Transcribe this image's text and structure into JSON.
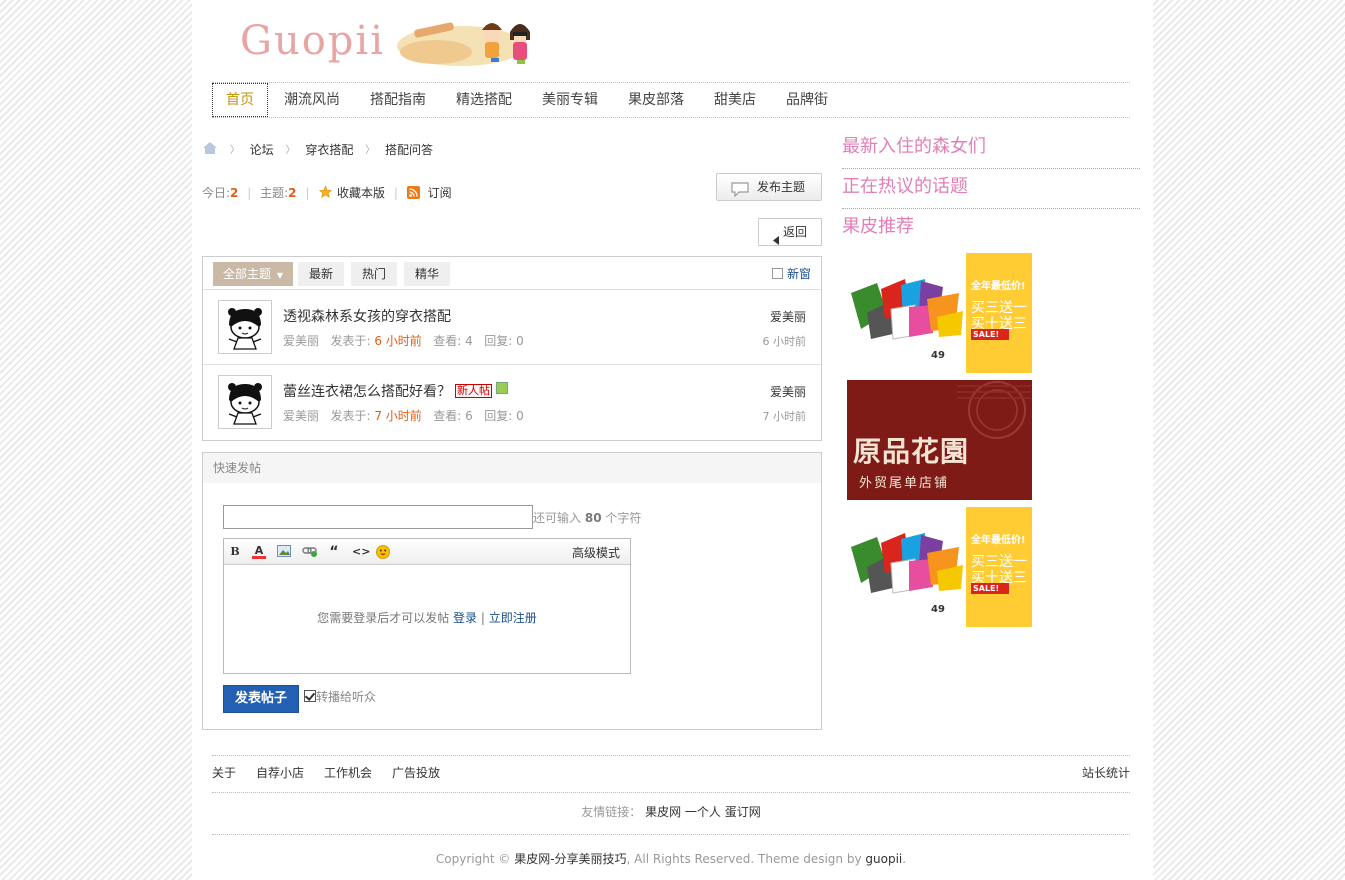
{
  "logo": {
    "text": "Guopii"
  },
  "nav": [
    {
      "label": "首页",
      "active": true
    },
    {
      "label": "潮流风尚"
    },
    {
      "label": "搭配指南"
    },
    {
      "label": "精选搭配"
    },
    {
      "label": "美丽专辑"
    },
    {
      "label": "果皮部落"
    },
    {
      "label": "甜美店"
    },
    {
      "label": "品牌街"
    }
  ],
  "breadcrumb": [
    "论坛",
    "穿衣搭配",
    "搭配问答"
  ],
  "stats": {
    "today_label": "今日:",
    "today_value": "2",
    "topics_label": "主题:",
    "topics_value": "2",
    "favorite_label": "收藏本版",
    "subscribe_label": "订阅"
  },
  "buttons": {
    "post": "发布主题",
    "back": "返回"
  },
  "tabs": [
    {
      "label": "全部主题",
      "active": true
    },
    {
      "label": "最新"
    },
    {
      "label": "热门"
    },
    {
      "label": "精华"
    }
  ],
  "new_window_label": "新窗",
  "threads": [
    {
      "title": "透视森林系女孩的穿衣搭配",
      "author": "爱美丽",
      "posted_label": "发表于:",
      "posted": "6 小时前",
      "views_label": "查看:",
      "views": "4",
      "replies_label": "回复:",
      "replies": "0",
      "last_author": "爱美丽",
      "last_time": "6 小时前",
      "badges": []
    },
    {
      "title": "蕾丝连衣裙怎么搭配好看？",
      "author": "爱美丽",
      "posted_label": "发表于:",
      "posted": "7 小时前",
      "views_label": "查看:",
      "views": "6",
      "replies_label": "回复:",
      "replies": "0",
      "last_author": "爱美丽",
      "last_time": "7 小时前",
      "badges": [
        "新人帖",
        "image-attachment-icon"
      ]
    }
  ],
  "quick_post": {
    "header": "快速发帖",
    "remaining_prefix": "还可输入",
    "remaining_count": "80",
    "remaining_suffix": "个字符",
    "advanced_mode": "高级模式",
    "login_note": "您需要登录后才可以发帖",
    "login_link": "登录",
    "divider": "|",
    "register_link": "立即注册",
    "submit": "发表帖子",
    "relay_label": "转播给听众",
    "toolbar_icons": [
      "bold-icon",
      "font-color-icon",
      "image-icon",
      "link-icon",
      "quote-icon",
      "code-icon",
      "smiley-icon"
    ]
  },
  "sidebar": {
    "titles": [
      "最新入住的森女们",
      "正在热议的话题",
      "果皮推荐"
    ],
    "ads": [
      {
        "kind": "cushion",
        "headline": "全年最低价!",
        "line1": "买三送一",
        "line2": "买十送三",
        "button": "SALE!",
        "price": "49"
      },
      {
        "kind": "garden",
        "headline": "原品花園",
        "sub": "外贸尾单店铺"
      },
      {
        "kind": "cushion",
        "headline": "全年最低价!",
        "line1": "买三送一",
        "line2": "买十送三",
        "button": "SALE!",
        "price": "49"
      }
    ]
  },
  "footer": {
    "links": [
      "关于",
      "自荐小店",
      "工作机会",
      "广告投放"
    ],
    "stats_link": "站长统计",
    "friends_label": "友情链接：",
    "friends": [
      "果皮网",
      "一个人",
      "蛋订网"
    ],
    "copyright_prefix": "Copyright ©",
    "site_name": "果皮网-分享美丽技巧",
    "rights": ", All Rights Reserved. Theme design by",
    "designer": "guopii",
    "end": "."
  },
  "colors": {
    "accent_pink": "#e27fb7",
    "nav_active": "#c8920d",
    "red_text": "#e55b12",
    "submit_blue": "#2360b4",
    "tab_active": "#c9b9a6"
  }
}
